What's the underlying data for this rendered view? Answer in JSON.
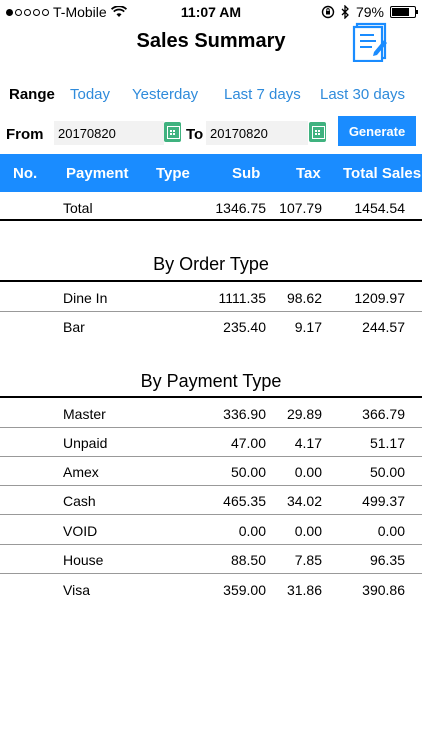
{
  "status_bar": {
    "carrier": "T-Mobile",
    "time": "11:07 AM",
    "battery": "79%",
    "battery_level": 0.79,
    "signal_icon": "signal-dots-icon",
    "wifi_icon": "wifi-icon",
    "lock_icon": "orientation-lock-icon",
    "bluetooth_icon": "bluetooth-icon"
  },
  "nav": {
    "title": "Sales Summary",
    "report_icon": "report-document-icon"
  },
  "range": {
    "label": "Range",
    "options": [
      "Today",
      "Yesterday",
      "Last 7 days",
      "Last 30 days"
    ]
  },
  "dates": {
    "from_label": "From",
    "from_value": "20170820",
    "to_label": "To",
    "to_value": "20170820",
    "calendar_icon": "calendar-icon",
    "generate_label": "Generate"
  },
  "table_header": {
    "no": "No.",
    "payment": "Payment",
    "type": "Type",
    "sub": "Sub",
    "tax": "Tax",
    "total": "Total Sales"
  },
  "total_row": {
    "name": "Total",
    "sub": "1346.75",
    "tax": "107.79",
    "total": "1454.54"
  },
  "order_type": {
    "title": "By Order Type",
    "rows": [
      {
        "name": "Dine In",
        "sub": "1111.35",
        "tax": "98.62",
        "total": "1209.97"
      },
      {
        "name": "Bar",
        "sub": "235.40",
        "tax": "9.17",
        "total": "244.57"
      }
    ]
  },
  "payment_type": {
    "title": "By Payment Type",
    "rows": [
      {
        "name": "Master",
        "sub": "336.90",
        "tax": "29.89",
        "total": "366.79"
      },
      {
        "name": "Unpaid",
        "sub": "47.00",
        "tax": "4.17",
        "total": "51.17"
      },
      {
        "name": "Amex",
        "sub": "50.00",
        "tax": "0.00",
        "total": "50.00"
      },
      {
        "name": "Cash",
        "sub": "465.35",
        "tax": "34.02",
        "total": "499.37"
      },
      {
        "name": "VOID",
        "sub": "0.00",
        "tax": "0.00",
        "total": "0.00"
      },
      {
        "name": "House",
        "sub": "88.50",
        "tax": "7.85",
        "total": "96.35"
      },
      {
        "name": "Visa",
        "sub": "359.00",
        "tax": "31.86",
        "total": "390.86"
      }
    ]
  },
  "colors": {
    "accent": "#1a8cff",
    "link": "#2f8bdb",
    "calendar": "#3fb27f"
  }
}
